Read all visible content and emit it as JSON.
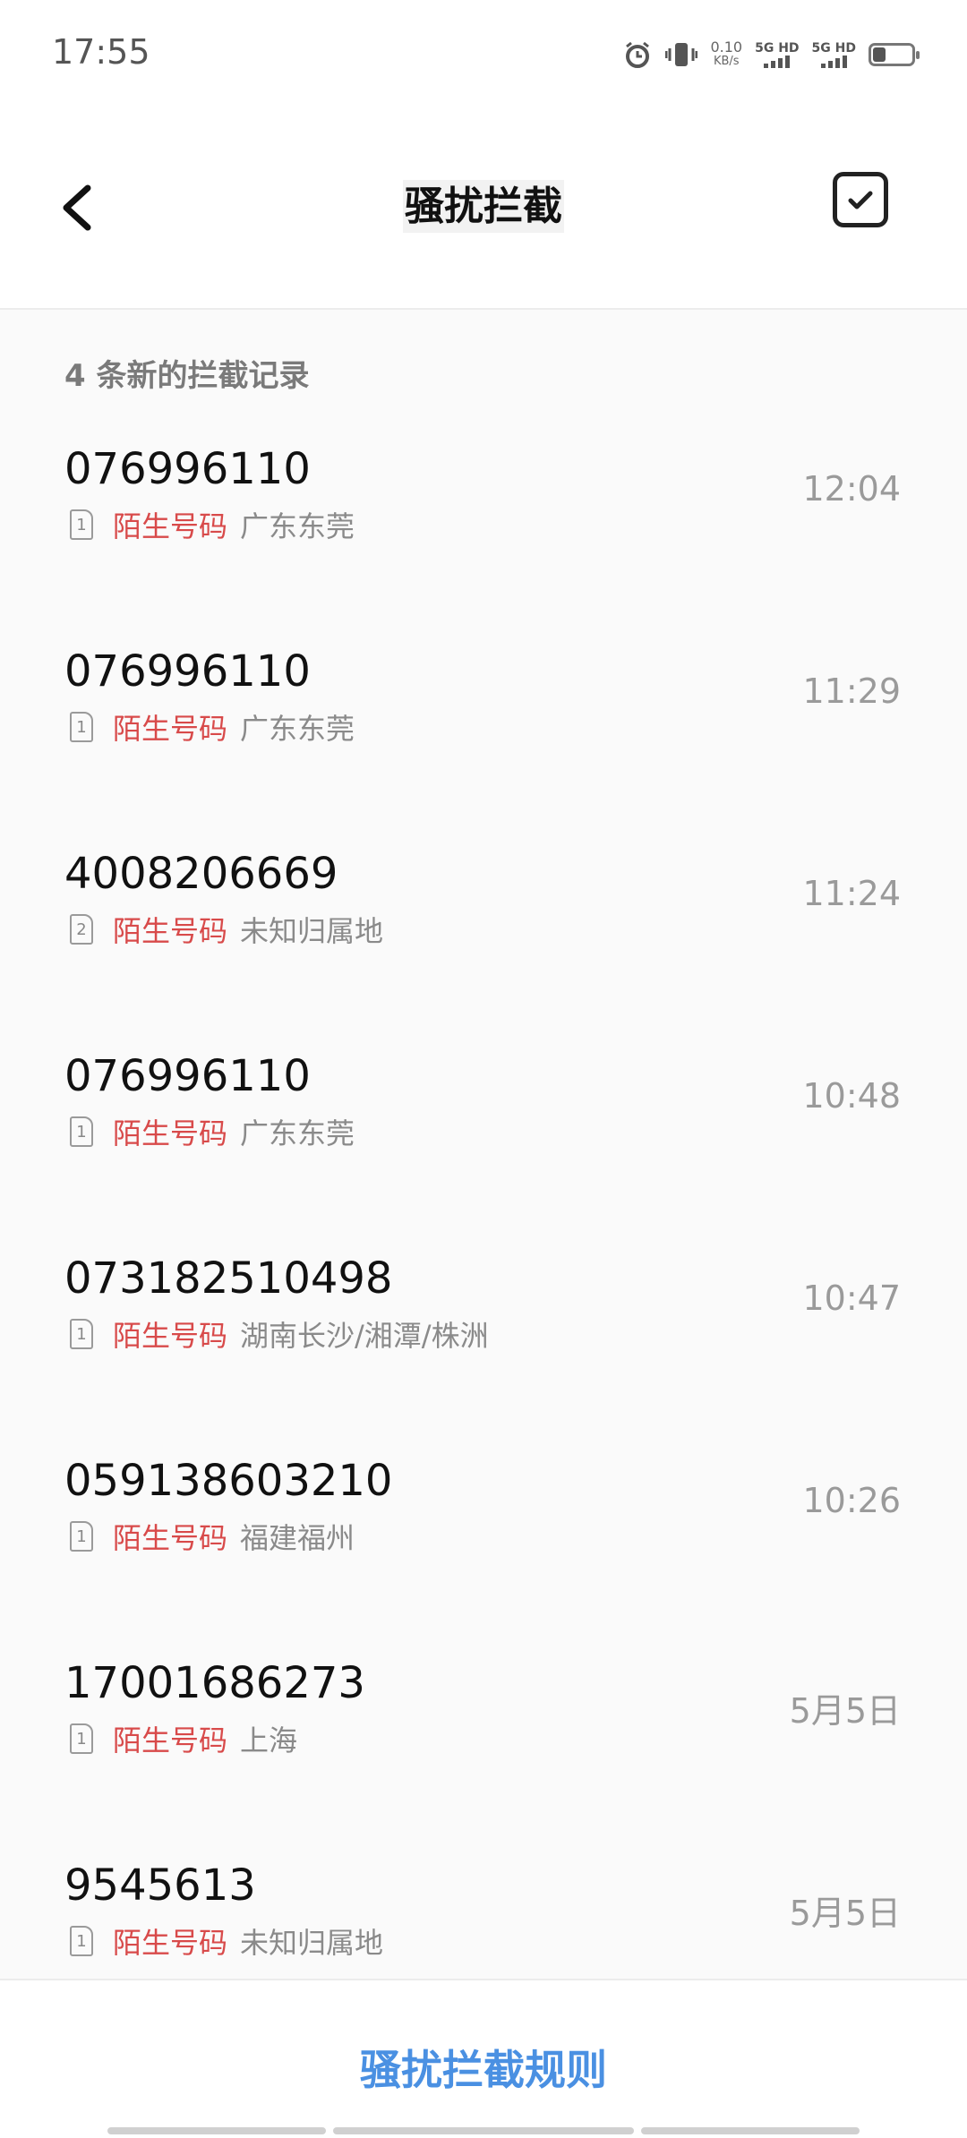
{
  "status_bar": {
    "time": "17:55",
    "speed_value": "0.10",
    "speed_unit": "KB/s",
    "sim1_label": "5G HD",
    "sim2_label": "5G HD",
    "icons": [
      "alarm-icon",
      "vibrate-icon",
      "signal-icon",
      "battery-icon"
    ]
  },
  "header": {
    "title": "骚扰拦截",
    "back_icon": "chevron-left-icon",
    "select_icon": "checkbox-icon"
  },
  "section": {
    "title": "4 条新的拦截记录"
  },
  "records": [
    {
      "number": "076996110",
      "sim": "1",
      "tag": "陌生号码",
      "location": "广东东莞",
      "time": "12:04"
    },
    {
      "number": "076996110",
      "sim": "1",
      "tag": "陌生号码",
      "location": "广东东莞",
      "time": "11:29"
    },
    {
      "number": "4008206669",
      "sim": "2",
      "tag": "陌生号码",
      "location": "未知归属地",
      "time": "11:24"
    },
    {
      "number": "076996110",
      "sim": "1",
      "tag": "陌生号码",
      "location": "广东东莞",
      "time": "10:48"
    },
    {
      "number": "073182510498",
      "sim": "1",
      "tag": "陌生号码",
      "location": "湖南长沙/湘潭/株洲",
      "time": "10:47"
    },
    {
      "number": "059138603210",
      "sim": "1",
      "tag": "陌生号码",
      "location": "福建福州",
      "time": "10:26"
    },
    {
      "number": "17001686273",
      "sim": "1",
      "tag": "陌生号码",
      "location": "上海",
      "time": "5月5日"
    },
    {
      "number": "9545613",
      "sim": "1",
      "tag": "陌生号码",
      "location": "未知归属地",
      "time": "5月5日"
    }
  ],
  "footer": {
    "rules_label": "骚扰拦截规则"
  },
  "colors": {
    "tag_red": "#d84a4a",
    "accent_blue": "#4a90e2"
  }
}
